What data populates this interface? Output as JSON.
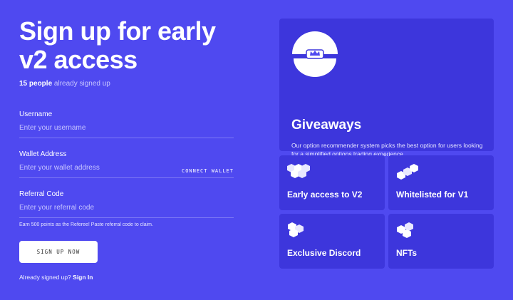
{
  "signup": {
    "title_line1": "Sign up for early",
    "title_line2": "v2 access",
    "signed_count": "15 people",
    "signed_suffix": "already signed up",
    "fields": {
      "username_label": "Username",
      "username_placeholder": "Enter your username",
      "wallet_label": "Wallet Address",
      "wallet_placeholder": "Enter your wallet address",
      "connect_wallet": "CONNECT WALLET",
      "referral_label": "Referral Code",
      "referral_placeholder": "Enter your referral code"
    },
    "hint": "Earn 500 points as the Referee! Paste referral code to claim.",
    "button_label": "SIGN UP NOW",
    "already_text": "Already signed up?",
    "sign_in_label": "Sign In"
  },
  "features": {
    "giveaways": {
      "title": "Giveaways",
      "description": "Our option recommender system picks the best option for users looking for a simplified options trading experience",
      "icon": "crown-sphere-icon"
    },
    "cards": [
      {
        "title": "Early access to V2",
        "icon": "hex-cluster-icon"
      },
      {
        "title": "Whitelisted for V1",
        "icon": "hex-chain-icon"
      },
      {
        "title": "Exclusive Discord",
        "icon": "hex-stack-icon"
      },
      {
        "title": "NFTs",
        "icon": "hex-cubes-icon"
      }
    ]
  },
  "colors": {
    "background": "#4f49f0",
    "card": "#3d36dc",
    "button": "#ffffff"
  }
}
